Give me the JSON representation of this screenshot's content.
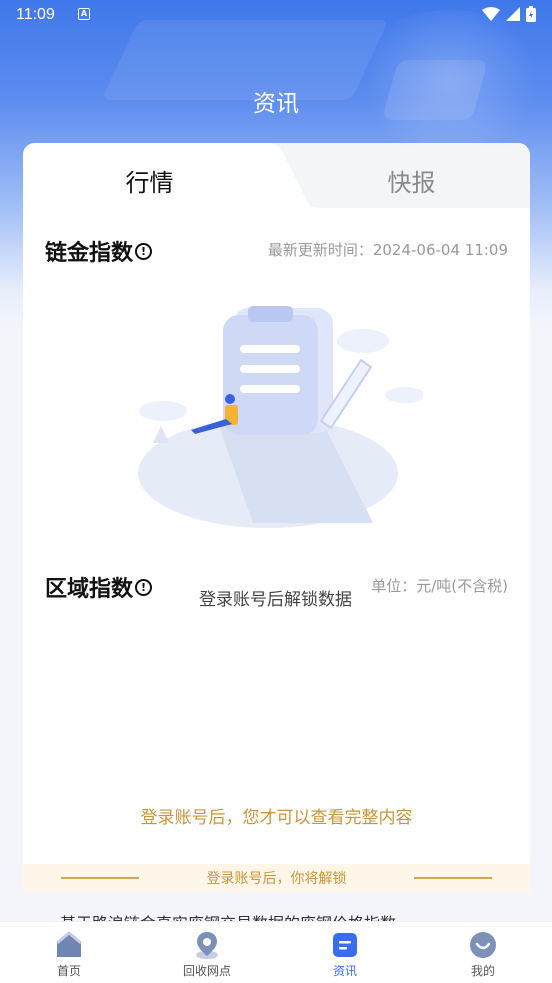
{
  "status": {
    "time": "11:09"
  },
  "header": {
    "title": "资讯"
  },
  "tabs": [
    {
      "label": "行情",
      "active": true
    },
    {
      "label": "快报",
      "active": false
    }
  ],
  "chain_index": {
    "title": "链金指数",
    "update_label": "最新更新时间：",
    "update_time": "2024-06-04 11:09"
  },
  "region_index": {
    "title": "区域指数",
    "unit": "单位：元/吨(不含税)",
    "locked_text": "登录账号后解锁数据"
  },
  "login_tip": "登录账号后，您才可以查看完整内容",
  "unlock_banner": "登录账号后，你将解锁",
  "partial_text": "基于路浪链金真实废钢交易数据的废钢价格指数",
  "nav": [
    {
      "label": "首页",
      "icon": "home-icon",
      "active": false
    },
    {
      "label": "回收网点",
      "icon": "location-pin-icon",
      "active": false
    },
    {
      "label": "资讯",
      "icon": "news-icon",
      "active": true
    },
    {
      "label": "我的",
      "icon": "profile-icon",
      "active": false
    }
  ],
  "colors": {
    "primary": "#3b6cf0",
    "gold": "#c9953b",
    "banner_bg": "#fdf6e9"
  }
}
